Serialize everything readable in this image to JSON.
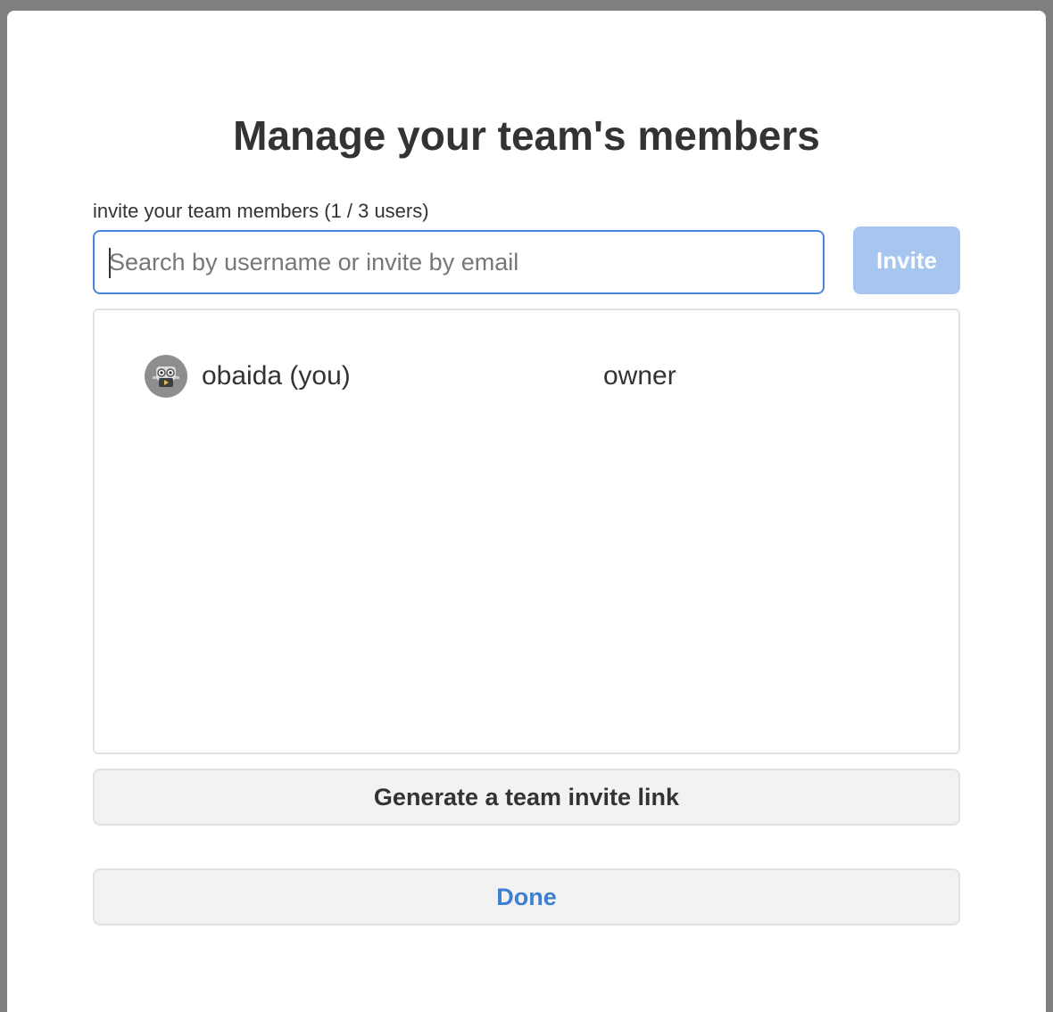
{
  "dialog": {
    "title": "Manage your team's members",
    "invite_label": "invite your team members (1 / 3 users)",
    "search": {
      "placeholder": "Search by username or invite by email",
      "value": ""
    },
    "invite_button_label": "Invite",
    "members": [
      {
        "name": "obaida (you)",
        "role": "owner",
        "avatar_icon": "robot-avatar-icon"
      }
    ],
    "generate_link_label": "Generate a team invite link",
    "done_label": "Done"
  },
  "colors": {
    "accent": "#4a86d6",
    "invite_button_disabled": "#a6c5ef",
    "done_text": "#3f7fd1",
    "backdrop": "#7f7f7f"
  }
}
